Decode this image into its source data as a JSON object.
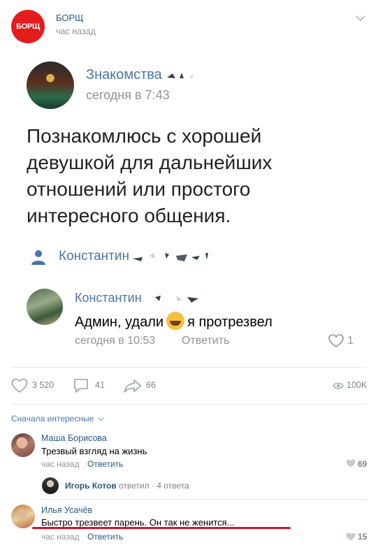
{
  "header": {
    "avatar_text": "БОРЩ",
    "group_name": "БОРЩ",
    "post_time": "час назад"
  },
  "inner": {
    "group_name": "Знакомства",
    "time": "сегодня в 7:43",
    "post_text": "Познакомлюсь с хорошей девушкой для дальнейших отношений или простого интересного общения.",
    "author_name": "Константин",
    "comment": {
      "name": "Константин",
      "text_before": "Админ, удали",
      "text_after": "я протрезвел",
      "time": "сегодня в 10:53",
      "reply": "Ответить",
      "likes": "1"
    }
  },
  "actions": {
    "likes": "3 520",
    "comments": "41",
    "shares": "66",
    "views": "100K"
  },
  "sort_label": "Сначала интересные",
  "comments": [
    {
      "name": "Маша Борисова",
      "text": "Трезвый взгляд на жизнь",
      "time": "час назад",
      "reply": "Ответить",
      "likes": "69"
    },
    {
      "name": "Илья Усачёв",
      "text": "Быстро трезвеет парень. Он так не женится...",
      "time": "час назад",
      "reply": "Ответить",
      "likes": "15"
    }
  ],
  "thread": {
    "name": "Игорь Котов",
    "answered": "ответил",
    "count": "· 4 ответа"
  },
  "colors": {
    "link": "#2a5885",
    "brand_red": "#e31c1c",
    "highlight": "#d0142b"
  }
}
